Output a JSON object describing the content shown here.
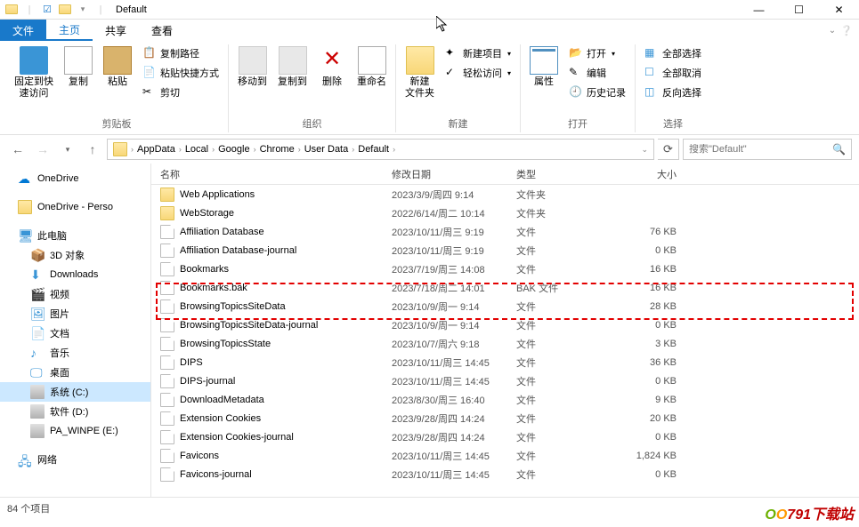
{
  "window": {
    "title": "Default"
  },
  "tabs": {
    "file": "文件",
    "home": "主页",
    "share": "共享",
    "view": "查看"
  },
  "ribbon": {
    "pin": "固定到快\n速访问",
    "copy": "复制",
    "paste": "粘贴",
    "copy_path": "复制路径",
    "paste_shortcut": "粘贴快捷方式",
    "cut": "剪切",
    "clipboard_group": "剪贴板",
    "move_to": "移动到",
    "copy_to": "复制到",
    "delete": "删除",
    "rename": "重命名",
    "organize_group": "组织",
    "new_folder": "新建\n文件夹",
    "new_item": "新建项目",
    "easy_access": "轻松访问",
    "new_group": "新建",
    "properties": "属性",
    "open": "打开",
    "edit": "编辑",
    "history": "历史记录",
    "open_group": "打开",
    "select_all": "全部选择",
    "select_none": "全部取消",
    "invert": "反向选择",
    "select_group": "选择"
  },
  "breadcrumbs": [
    "AppData",
    "Local",
    "Google",
    "Chrome",
    "User Data",
    "Default"
  ],
  "search": {
    "placeholder": "搜索\"Default\""
  },
  "nav": {
    "onedrive": "OneDrive",
    "onedrive_personal": "OneDrive - Perso",
    "this_pc": "此电脑",
    "objects_3d": "3D 对象",
    "downloads": "Downloads",
    "videos": "视频",
    "pictures": "图片",
    "documents": "文档",
    "music": "音乐",
    "desktop": "桌面",
    "drive_c": "系统 (C:)",
    "drive_d": "软件 (D:)",
    "drive_e": "PA_WINPE (E:)",
    "network": "网络"
  },
  "columns": {
    "name": "名称",
    "date": "修改日期",
    "type": "类型",
    "size": "大小"
  },
  "files": [
    {
      "icon": "folder",
      "name": "Web Applications",
      "date": "2023/3/9/周四 9:14",
      "type": "文件夹",
      "size": ""
    },
    {
      "icon": "folder",
      "name": "WebStorage",
      "date": "2022/6/14/周二 10:14",
      "type": "文件夹",
      "size": ""
    },
    {
      "icon": "file",
      "name": "Affiliation Database",
      "date": "2023/10/11/周三 9:19",
      "type": "文件",
      "size": "76 KB"
    },
    {
      "icon": "file",
      "name": "Affiliation Database-journal",
      "date": "2023/10/11/周三 9:19",
      "type": "文件",
      "size": "0 KB"
    },
    {
      "icon": "file",
      "name": "Bookmarks",
      "date": "2023/7/19/周三 14:08",
      "type": "文件",
      "size": "16 KB"
    },
    {
      "icon": "file",
      "name": "Bookmarks.bak",
      "date": "2023/7/18/周二 14:01",
      "type": "BAK 文件",
      "size": "16 KB"
    },
    {
      "icon": "file",
      "name": "BrowsingTopicsSiteData",
      "date": "2023/10/9/周一 9:14",
      "type": "文件",
      "size": "28 KB"
    },
    {
      "icon": "file",
      "name": "BrowsingTopicsSiteData-journal",
      "date": "2023/10/9/周一 9:14",
      "type": "文件",
      "size": "0 KB"
    },
    {
      "icon": "file",
      "name": "BrowsingTopicsState",
      "date": "2023/10/7/周六 9:18",
      "type": "文件",
      "size": "3 KB"
    },
    {
      "icon": "file",
      "name": "DIPS",
      "date": "2023/10/11/周三 14:45",
      "type": "文件",
      "size": "36 KB"
    },
    {
      "icon": "file",
      "name": "DIPS-journal",
      "date": "2023/10/11/周三 14:45",
      "type": "文件",
      "size": "0 KB"
    },
    {
      "icon": "file",
      "name": "DownloadMetadata",
      "date": "2023/8/30/周三 16:40",
      "type": "文件",
      "size": "9 KB"
    },
    {
      "icon": "file",
      "name": "Extension Cookies",
      "date": "2023/9/28/周四 14:24",
      "type": "文件",
      "size": "20 KB"
    },
    {
      "icon": "file",
      "name": "Extension Cookies-journal",
      "date": "2023/9/28/周四 14:24",
      "type": "文件",
      "size": "0 KB"
    },
    {
      "icon": "file",
      "name": "Favicons",
      "date": "2023/10/11/周三 14:45",
      "type": "文件",
      "size": "1,824 KB"
    },
    {
      "icon": "file",
      "name": "Favicons-journal",
      "date": "2023/10/11/周三 14:45",
      "type": "文件",
      "size": "0 KB"
    }
  ],
  "status": {
    "count": "84 个项目"
  },
  "watermark": {
    "brand1": "O",
    "brand2": "O",
    "rest": "791下载站"
  }
}
